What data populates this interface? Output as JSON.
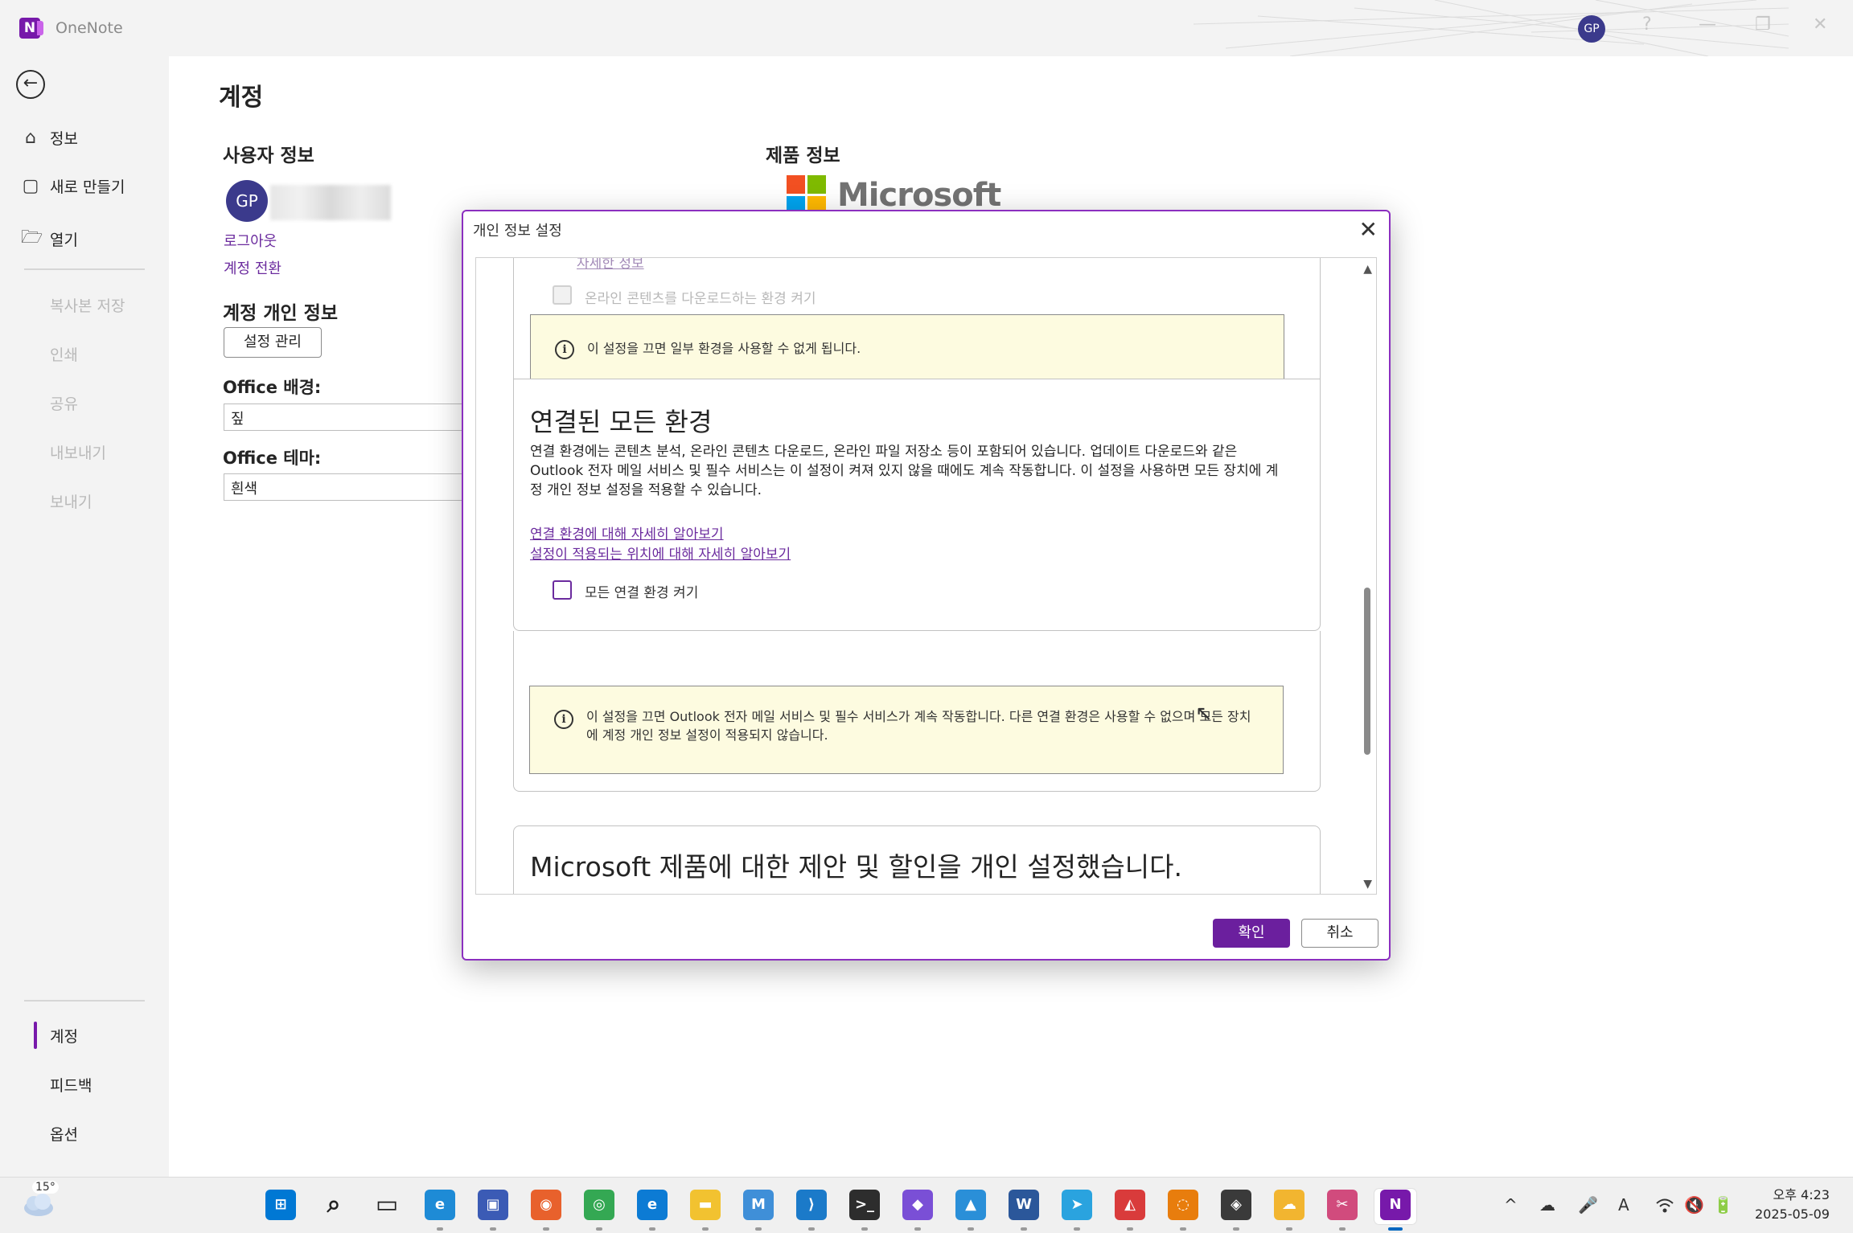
{
  "titlebar": {
    "app_name": "OneNote",
    "avatar_initials": "GP",
    "win_controls": [
      "?",
      "—",
      "❐",
      "✕"
    ]
  },
  "nav": {
    "back": "←",
    "items": [
      {
        "label": "정보",
        "icon": "home-icon",
        "glyph": "⌂"
      },
      {
        "label": "새로 만들기",
        "icon": "new-document-icon",
        "glyph": "▢"
      },
      {
        "label": "열기",
        "icon": "open-folder-icon",
        "glyph": "🗁"
      }
    ],
    "disabled_items": [
      "복사본 저장",
      "인쇄",
      "공유",
      "내보내기",
      "보내기"
    ],
    "bottom_items": [
      "계정",
      "피드백",
      "옵션"
    ]
  },
  "main": {
    "title": "계정",
    "user_info_title": "사용자 정보",
    "avatar_initials": "GP",
    "logout": "로그아웃",
    "switch_account": "계정 전환",
    "privacy_title": "계정 개인 정보",
    "manage_settings": "설정 관리",
    "background_label": "Office 배경:",
    "background_value": "짚",
    "theme_label": "Office 테마:",
    "theme_value": "흰색",
    "product_title": "제품 정보",
    "ms_brand": "Microsoft",
    "ms_colors": [
      "#f25022",
      "#7fba00",
      "#00a4ef",
      "#ffb900"
    ]
  },
  "dialog": {
    "title": "개인 정보 설정",
    "close": "✕",
    "partial_link": "자세한 정보",
    "online_content_checkbox": "온라인 콘텐츠를 다운로드하는 환경 켜기",
    "info1": "이 설정을 끄면 일부 환경을 사용할 수 없게 됩니다.",
    "connected_heading": "연결된 모든 환경",
    "connected_desc": "연결 환경에는 콘텐츠 분석, 온라인 콘텐츠 다운로드, 온라인 파일 저장소 등이 포함되어 있습니다. 업데이트 다운로드와 같은 Outlook 전자 메일 서비스 및 필수 서비스는 이 설정이 켜져 있지 않을 때에도 계속 작동합니다. 이 설정을 사용하면 모든 장치에 계정 개인 정보 설정을 적용할 수 있습니다.",
    "link1": "연결 환경에 대해 자세히 알아보기",
    "link2": "설정이 적용되는 위치에 대해 자세히 알아보기",
    "all_connected_checkbox": "모든 연결 환경 켜기",
    "info2": "이 설정을 끄면 Outlook 전자 메일 서비스 및 필수 서비스가 계속 작동합니다. 다른 연결 환경은 사용할 수 없으며 모든 장치에 계정 개인 정보 설정이 적용되지 않습니다.",
    "offers_heading": "Microsoft 제품에 대한 제안 및 할인을 개인 설정했습니다.",
    "ok": "확인",
    "cancel": "취소"
  },
  "taskbar": {
    "weather_temp": "15°",
    "time": "오후 4:23",
    "date": "2025-05-09",
    "apps": [
      {
        "name": "start-icon",
        "color": "#0078d4",
        "glyph": "⊞"
      },
      {
        "name": "search-icon",
        "color": "#ffffff",
        "glyph": "⌕"
      },
      {
        "name": "task-view-icon",
        "color": "#ffffff",
        "glyph": "▭"
      },
      {
        "name": "edge-preview-icon",
        "color": "#1e8bd6",
        "glyph": "e"
      },
      {
        "name": "save-disk-icon",
        "color": "#3b5bb5",
        "glyph": "▣"
      },
      {
        "name": "firefox-icon",
        "color": "#e8612c",
        "glyph": "◉"
      },
      {
        "name": "chrome-icon",
        "color": "#34a853",
        "glyph": "◎"
      },
      {
        "name": "edge-icon",
        "color": "#0c7bd4",
        "glyph": "e"
      },
      {
        "name": "file-explorer-icon",
        "color": "#f2c230",
        "glyph": "▬"
      },
      {
        "name": "copilot-m365-icon",
        "color": "#3f8fd8",
        "glyph": "M"
      },
      {
        "name": "vscode-icon",
        "color": "#1b7ac9",
        "glyph": "⟩"
      },
      {
        "name": "terminal-icon",
        "color": "#2d2d2d",
        "glyph": ">_"
      },
      {
        "name": "obsidian-icon",
        "color": "#7a4fd6",
        "glyph": "◆"
      },
      {
        "name": "photos-icon",
        "color": "#2a8fd8",
        "glyph": "▲"
      },
      {
        "name": "word-design-icon",
        "color": "#2b579a",
        "glyph": "W"
      },
      {
        "name": "telegram-icon",
        "color": "#2aa3df",
        "glyph": "➤"
      },
      {
        "name": "color-app-icon",
        "color": "#d93b3b",
        "glyph": "◭"
      },
      {
        "name": "blender-icon",
        "color": "#e87d0d",
        "glyph": "◌"
      },
      {
        "name": "davinci-icon",
        "color": "#3a3a3a",
        "glyph": "◈"
      },
      {
        "name": "weather-app-icon",
        "color": "#f2b530",
        "glyph": "☁"
      },
      {
        "name": "snipping-tool-icon",
        "color": "#d14b7d",
        "glyph": "✂"
      },
      {
        "name": "onenote-taskbar-icon",
        "color": "#7719aa",
        "glyph": "N"
      }
    ],
    "tray": [
      "^",
      "☁",
      "🎤",
      "A",
      "wifi",
      "🔇",
      "🔋"
    ]
  }
}
